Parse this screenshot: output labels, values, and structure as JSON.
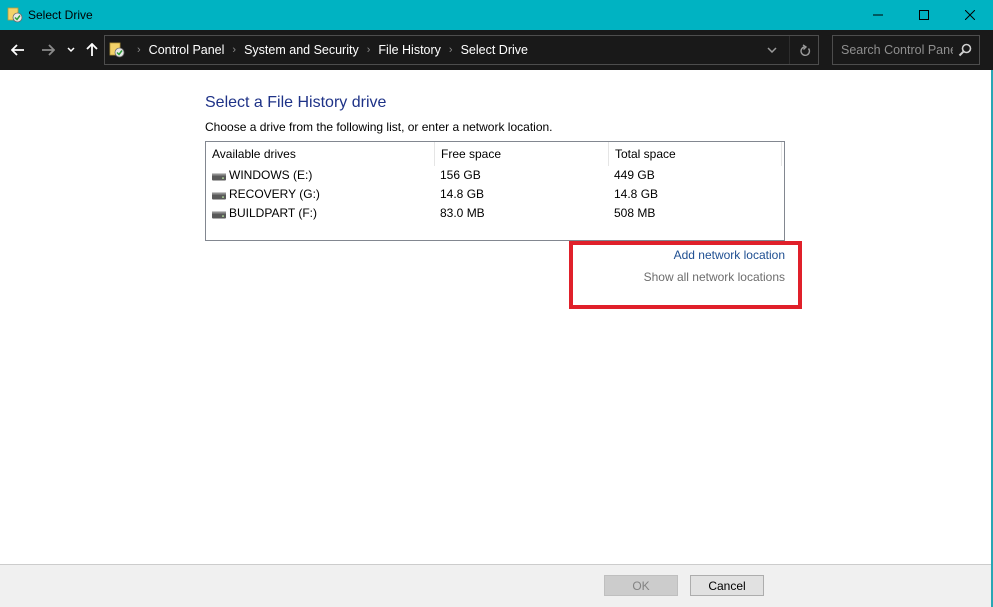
{
  "window": {
    "title": "Select Drive",
    "controls": {
      "minimize": "minimize",
      "maximize": "maximize",
      "close": "close"
    }
  },
  "navigation": {
    "back_icon": "arrow-left-icon",
    "forward_icon": "arrow-right-icon",
    "recent_icon": "chevron-down-icon",
    "up_icon": "arrow-up-icon",
    "breadcrumbs": [
      "Control Panel",
      "System and Security",
      "File History",
      "Select Drive"
    ],
    "search": {
      "placeholder": "Search Control Panel",
      "value": ""
    }
  },
  "content": {
    "heading": "Select a File History drive",
    "instruction": "Choose a drive from the following list, or enter a network location.",
    "table": {
      "columns": [
        "Available drives",
        "Free space",
        "Total space"
      ],
      "rows": [
        {
          "name": "WINDOWS (E:)",
          "free": "156 GB",
          "total": "449 GB"
        },
        {
          "name": "RECOVERY (G:)",
          "free": "14.8 GB",
          "total": "14.8 GB"
        },
        {
          "name": "BUILDPART (F:)",
          "free": "83.0 MB",
          "total": "508 MB"
        }
      ]
    },
    "links": {
      "add_network": "Add network location",
      "show_all_network": "Show all network locations"
    },
    "highlight_color": "#e0202a"
  },
  "footer": {
    "ok_label": "OK",
    "cancel_label": "Cancel",
    "ok_enabled": false
  },
  "colors": {
    "titlebar": "#00b3c2",
    "navbar": "#191919",
    "heading": "#1e3287",
    "link": "#1e4e91"
  }
}
